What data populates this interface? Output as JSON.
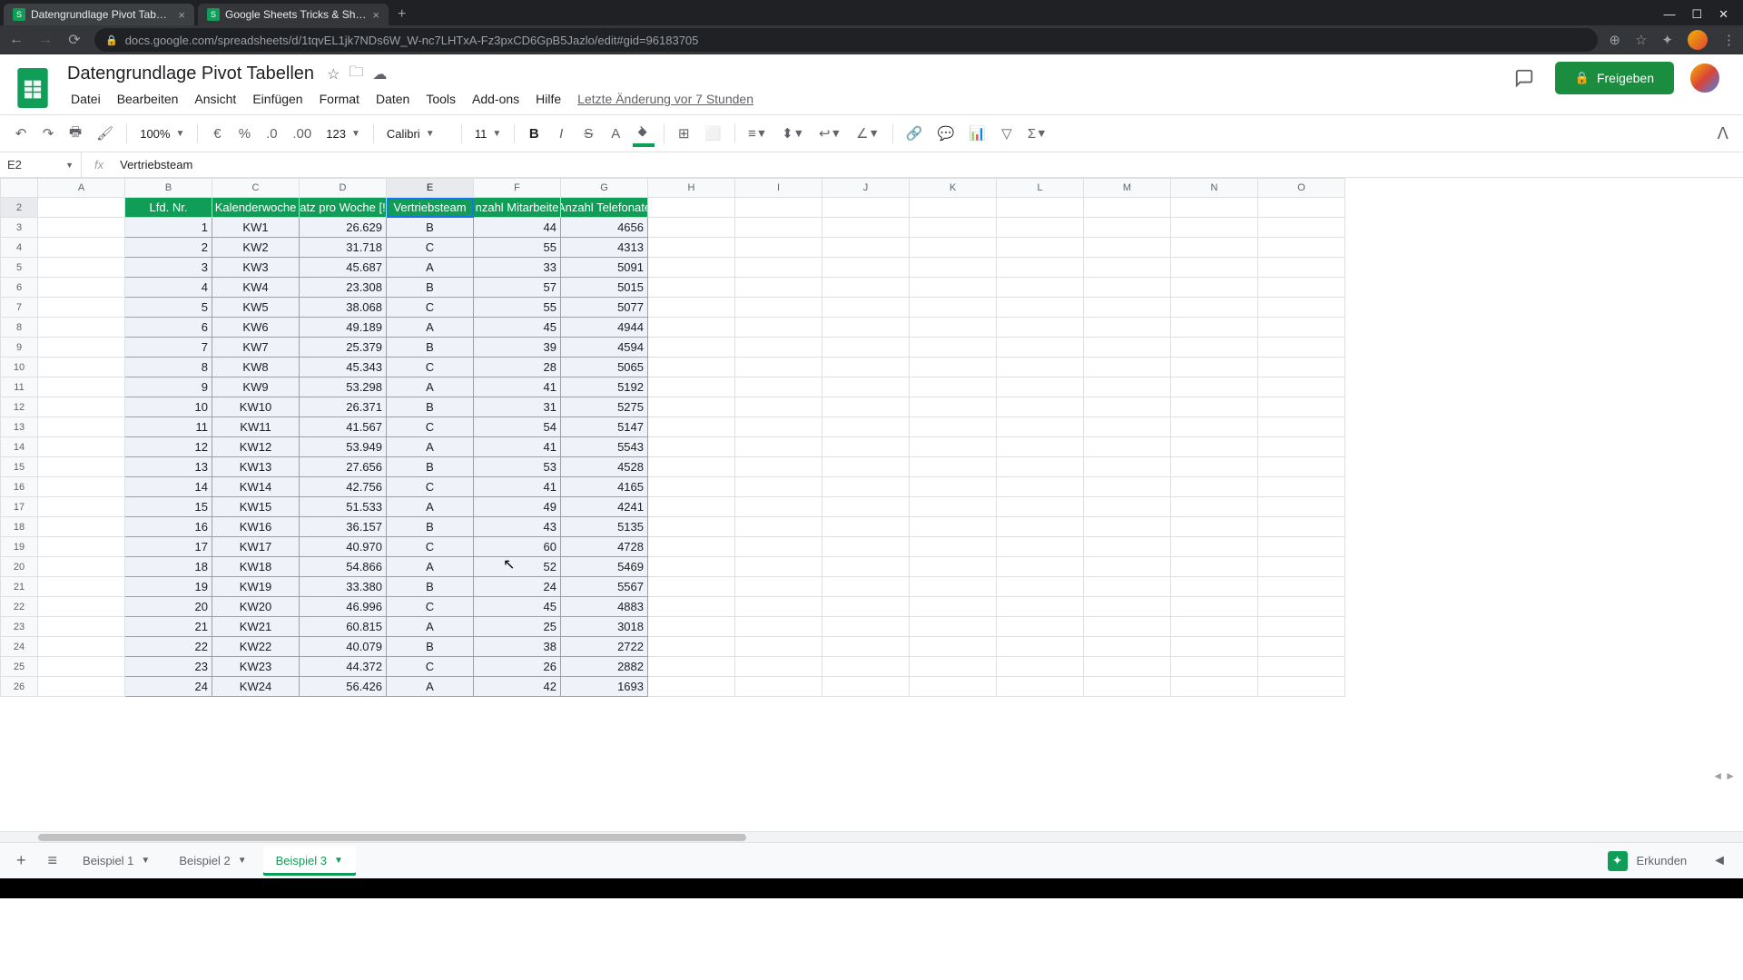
{
  "browser": {
    "tabs": [
      {
        "title": "Datengrundlage Pivot Tabellen",
        "favicon": "S"
      },
      {
        "title": "Google Sheets Tricks & Shortcuts",
        "favicon": "S"
      }
    ],
    "url": "docs.google.com/spreadsheets/d/1tqvEL1jk7NDs6W_W-nc7LHTxA-Fz3pxCD6GpB5Jazlo/edit#gid=96183705"
  },
  "doc": {
    "title": "Datengrundlage Pivot Tabellen",
    "last_edit": "Letzte Änderung vor 7 Stunden"
  },
  "menu": {
    "items": [
      "Datei",
      "Bearbeiten",
      "Ansicht",
      "Einfügen",
      "Format",
      "Daten",
      "Tools",
      "Add-ons",
      "Hilfe"
    ]
  },
  "share": {
    "label": "Freigeben"
  },
  "toolbar": {
    "zoom": "100%",
    "format_number": "123",
    "font": "Calibri",
    "font_size": "11"
  },
  "namebox": {
    "ref": "E2"
  },
  "formula": {
    "value": "Vertriebsteam"
  },
  "columns": [
    "A",
    "B",
    "C",
    "D",
    "E",
    "F",
    "G",
    "H",
    "I",
    "J",
    "K",
    "L",
    "M",
    "N",
    "O"
  ],
  "row_start": 2,
  "row_end": 26,
  "table": {
    "headers": [
      "Lfd. Nr.",
      "Kalenderwoche",
      "atz pro Woche [!",
      "Vertriebsteam",
      "nzahl Mitarbeite",
      "Anzahl Telefonate"
    ],
    "rows": [
      [
        1,
        "KW1",
        "26.629",
        "B",
        44,
        4656
      ],
      [
        2,
        "KW2",
        "31.718",
        "C",
        55,
        4313
      ],
      [
        3,
        "KW3",
        "45.687",
        "A",
        33,
        5091
      ],
      [
        4,
        "KW4",
        "23.308",
        "B",
        57,
        5015
      ],
      [
        5,
        "KW5",
        "38.068",
        "C",
        55,
        5077
      ],
      [
        6,
        "KW6",
        "49.189",
        "A",
        45,
        4944
      ],
      [
        7,
        "KW7",
        "25.379",
        "B",
        39,
        4594
      ],
      [
        8,
        "KW8",
        "45.343",
        "C",
        28,
        5065
      ],
      [
        9,
        "KW9",
        "53.298",
        "A",
        41,
        5192
      ],
      [
        10,
        "KW10",
        "26.371",
        "B",
        31,
        5275
      ],
      [
        11,
        "KW11",
        "41.567",
        "C",
        54,
        5147
      ],
      [
        12,
        "KW12",
        "53.949",
        "A",
        41,
        5543
      ],
      [
        13,
        "KW13",
        "27.656",
        "B",
        53,
        4528
      ],
      [
        14,
        "KW14",
        "42.756",
        "C",
        41,
        4165
      ],
      [
        15,
        "KW15",
        "51.533",
        "A",
        49,
        4241
      ],
      [
        16,
        "KW16",
        "36.157",
        "B",
        43,
        5135
      ],
      [
        17,
        "KW17",
        "40.970",
        "C",
        60,
        4728
      ],
      [
        18,
        "KW18",
        "54.866",
        "A",
        52,
        5469
      ],
      [
        19,
        "KW19",
        "33.380",
        "B",
        24,
        5567
      ],
      [
        20,
        "KW20",
        "46.996",
        "C",
        45,
        4883
      ],
      [
        21,
        "KW21",
        "60.815",
        "A",
        25,
        3018
      ],
      [
        22,
        "KW22",
        "40.079",
        "B",
        38,
        2722
      ],
      [
        23,
        "KW23",
        "44.372",
        "C",
        26,
        2882
      ],
      [
        24,
        "KW24",
        "56.426",
        "A",
        42,
        1693
      ]
    ]
  },
  "sheets": {
    "tabs": [
      "Beispiel 1",
      "Beispiel 2",
      "Beispiel 3"
    ],
    "active": 2,
    "explore": "Erkunden"
  }
}
